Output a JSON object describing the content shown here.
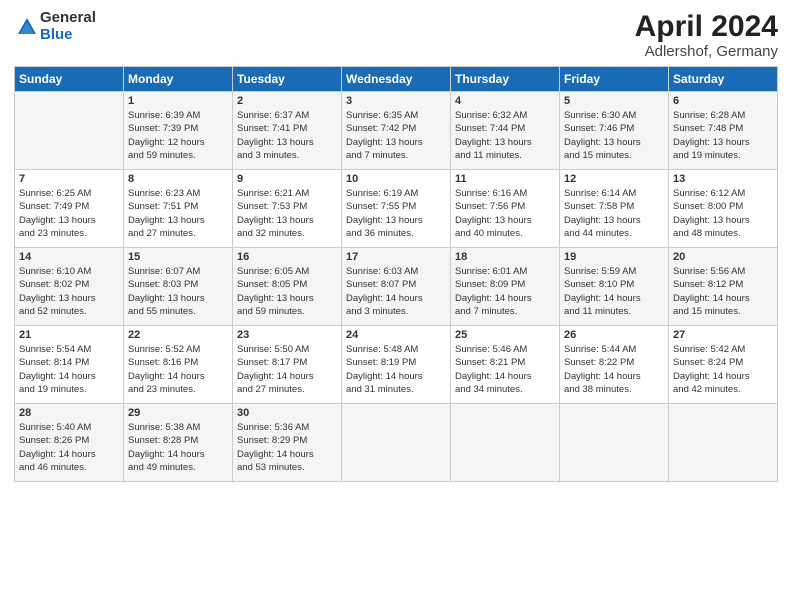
{
  "header": {
    "logo_general": "General",
    "logo_blue": "Blue",
    "title": "April 2024",
    "subtitle": "Adlershof, Germany"
  },
  "columns": [
    "Sunday",
    "Monday",
    "Tuesday",
    "Wednesday",
    "Thursday",
    "Friday",
    "Saturday"
  ],
  "weeks": [
    [
      {
        "day": "",
        "info": ""
      },
      {
        "day": "1",
        "info": "Sunrise: 6:39 AM\nSunset: 7:39 PM\nDaylight: 12 hours\nand 59 minutes."
      },
      {
        "day": "2",
        "info": "Sunrise: 6:37 AM\nSunset: 7:41 PM\nDaylight: 13 hours\nand 3 minutes."
      },
      {
        "day": "3",
        "info": "Sunrise: 6:35 AM\nSunset: 7:42 PM\nDaylight: 13 hours\nand 7 minutes."
      },
      {
        "day": "4",
        "info": "Sunrise: 6:32 AM\nSunset: 7:44 PM\nDaylight: 13 hours\nand 11 minutes."
      },
      {
        "day": "5",
        "info": "Sunrise: 6:30 AM\nSunset: 7:46 PM\nDaylight: 13 hours\nand 15 minutes."
      },
      {
        "day": "6",
        "info": "Sunrise: 6:28 AM\nSunset: 7:48 PM\nDaylight: 13 hours\nand 19 minutes."
      }
    ],
    [
      {
        "day": "7",
        "info": "Sunrise: 6:25 AM\nSunset: 7:49 PM\nDaylight: 13 hours\nand 23 minutes."
      },
      {
        "day": "8",
        "info": "Sunrise: 6:23 AM\nSunset: 7:51 PM\nDaylight: 13 hours\nand 27 minutes."
      },
      {
        "day": "9",
        "info": "Sunrise: 6:21 AM\nSunset: 7:53 PM\nDaylight: 13 hours\nand 32 minutes."
      },
      {
        "day": "10",
        "info": "Sunrise: 6:19 AM\nSunset: 7:55 PM\nDaylight: 13 hours\nand 36 minutes."
      },
      {
        "day": "11",
        "info": "Sunrise: 6:16 AM\nSunset: 7:56 PM\nDaylight: 13 hours\nand 40 minutes."
      },
      {
        "day": "12",
        "info": "Sunrise: 6:14 AM\nSunset: 7:58 PM\nDaylight: 13 hours\nand 44 minutes."
      },
      {
        "day": "13",
        "info": "Sunrise: 6:12 AM\nSunset: 8:00 PM\nDaylight: 13 hours\nand 48 minutes."
      }
    ],
    [
      {
        "day": "14",
        "info": "Sunrise: 6:10 AM\nSunset: 8:02 PM\nDaylight: 13 hours\nand 52 minutes."
      },
      {
        "day": "15",
        "info": "Sunrise: 6:07 AM\nSunset: 8:03 PM\nDaylight: 13 hours\nand 55 minutes."
      },
      {
        "day": "16",
        "info": "Sunrise: 6:05 AM\nSunset: 8:05 PM\nDaylight: 13 hours\nand 59 minutes."
      },
      {
        "day": "17",
        "info": "Sunrise: 6:03 AM\nSunset: 8:07 PM\nDaylight: 14 hours\nand 3 minutes."
      },
      {
        "day": "18",
        "info": "Sunrise: 6:01 AM\nSunset: 8:09 PM\nDaylight: 14 hours\nand 7 minutes."
      },
      {
        "day": "19",
        "info": "Sunrise: 5:59 AM\nSunset: 8:10 PM\nDaylight: 14 hours\nand 11 minutes."
      },
      {
        "day": "20",
        "info": "Sunrise: 5:56 AM\nSunset: 8:12 PM\nDaylight: 14 hours\nand 15 minutes."
      }
    ],
    [
      {
        "day": "21",
        "info": "Sunrise: 5:54 AM\nSunset: 8:14 PM\nDaylight: 14 hours\nand 19 minutes."
      },
      {
        "day": "22",
        "info": "Sunrise: 5:52 AM\nSunset: 8:16 PM\nDaylight: 14 hours\nand 23 minutes."
      },
      {
        "day": "23",
        "info": "Sunrise: 5:50 AM\nSunset: 8:17 PM\nDaylight: 14 hours\nand 27 minutes."
      },
      {
        "day": "24",
        "info": "Sunrise: 5:48 AM\nSunset: 8:19 PM\nDaylight: 14 hours\nand 31 minutes."
      },
      {
        "day": "25",
        "info": "Sunrise: 5:46 AM\nSunset: 8:21 PM\nDaylight: 14 hours\nand 34 minutes."
      },
      {
        "day": "26",
        "info": "Sunrise: 5:44 AM\nSunset: 8:22 PM\nDaylight: 14 hours\nand 38 minutes."
      },
      {
        "day": "27",
        "info": "Sunrise: 5:42 AM\nSunset: 8:24 PM\nDaylight: 14 hours\nand 42 minutes."
      }
    ],
    [
      {
        "day": "28",
        "info": "Sunrise: 5:40 AM\nSunset: 8:26 PM\nDaylight: 14 hours\nand 46 minutes."
      },
      {
        "day": "29",
        "info": "Sunrise: 5:38 AM\nSunset: 8:28 PM\nDaylight: 14 hours\nand 49 minutes."
      },
      {
        "day": "30",
        "info": "Sunrise: 5:36 AM\nSunset: 8:29 PM\nDaylight: 14 hours\nand 53 minutes."
      },
      {
        "day": "",
        "info": ""
      },
      {
        "day": "",
        "info": ""
      },
      {
        "day": "",
        "info": ""
      },
      {
        "day": "",
        "info": ""
      }
    ]
  ]
}
